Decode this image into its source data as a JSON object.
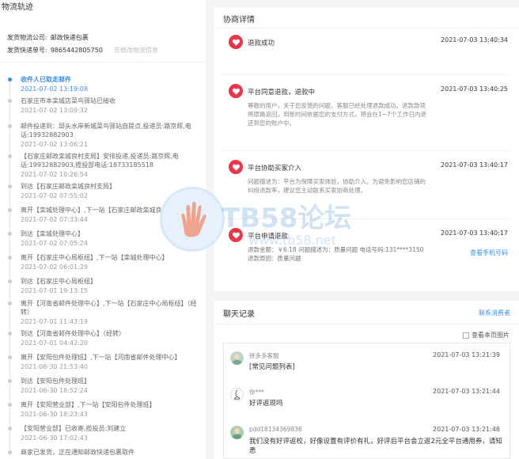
{
  "left": {
    "title": "物流轨迹",
    "company_label": "发货物流公司:",
    "company_value": "邮政快递包裹",
    "tracking_label": "发货快递单号:",
    "tracking_value": "9865442805750",
    "tracking_link": "去修改物流信息",
    "timeline": [
      {
        "text": "收件人已取走邮件",
        "time": "2021-07-02 13:19:08"
      },
      {
        "text": "石家庄市本栾城店菜鸟驿站已接收",
        "time": "2021-07-02 13:09:32"
      },
      {
        "text": "邮件投递到：邱头水岸新城菜鸟驿站自提点,投递员:路京辉,电话:19932882903",
        "time": "2021-07-02 13:06:21"
      },
      {
        "text": "【石家庄邮政栾城良村支局】安排投递,投递员:路京辉,电话:19932882903,揽投部电话:18733185518",
        "time": "2021-07-02 10:26:54"
      },
      {
        "text": "到达【石家庄邮政栾城良村支局】",
        "time": "2021-07-02 07:55:02"
      },
      {
        "text": "离开【栾城处理中心】,下一站【石家庄邮政栾城良村支局】",
        "time": "2021-07-02 07:33:44"
      },
      {
        "text": "到达【栾城处理中心】",
        "time": "2021-07-02 07:05:24"
      },
      {
        "text": "离开【石家庄中心局枢纽】,下一站【栾城处理中心】",
        "time": "2021-07-02 06:01:29"
      },
      {
        "text": "到达【石家庄中心局枢纽】",
        "time": "2021-07-01 19:13:15"
      },
      {
        "text": "离开【河南省邮件处理中心】,下一站【石家庄中心局枢纽】（经转）",
        "time": "2021-07-01 11:43:19"
      },
      {
        "text": "到达【河南省邮件处理中心】（经转）",
        "time": "2021-07-01 04:42:20"
      },
      {
        "text": "离开【安阳包件处理班】,下一站【河南省邮件处理中心】",
        "time": "2021-06-30 21:53:40"
      },
      {
        "text": "到达【安阳包件处理班】",
        "time": "2021-06-30 18:52:24"
      },
      {
        "text": "离开【安阳营业部】,下一站【安阳包件处理班】",
        "time": "2021-06-30 18:23:43"
      },
      {
        "text": "【安阳营业部】已收寄,揽投员:刘建立",
        "time": "2021-06-30 17:02:43"
      },
      {
        "text": "商家已发货，正在通知邮政快递包裹取件",
        "time": ""
      }
    ]
  },
  "detail": {
    "title": "协商详情",
    "events": [
      {
        "title": "退款成功",
        "time": "2021-07-03 13:40:34",
        "body": ""
      },
      {
        "title": "平台同意退款，退款中",
        "time": "2021-07-03 13:40:25",
        "body": "尊敬的用户，关于您反馈的问题，客服已经处理退款成功。退款款项将原路返回，到账时间依据您的支付方式，将会在1~7个工作日内退还到您的账户中。"
      },
      {
        "title": "平台协助买家介入",
        "time": "2021-07-03 13:40:17",
        "body": "问题描述为：平台为保障买家体验，协助介入。为避免影响您店铺的纠纷退款率，建议您主动联系买家协商处理。"
      },
      {
        "title": "平台申请退款",
        "time": "2021-07-03 13:40:17",
        "body": "退款金额：￥6.18 问题描述为：质量问题 电话号码:131****3150 退款原因：质量问题"
      }
    ],
    "phone_link": "查看手机号码"
  },
  "chat": {
    "title": "聊天记录",
    "link": "联系消费者",
    "show_images": "查看本页图片",
    "messages": [
      {
        "name": "拼多多客服",
        "time": "2021-07-03 13:21:39",
        "text": "[常见问题列表]"
      },
      {
        "name": "你***",
        "time": "2021-07-03 13:21:44",
        "text": "好评返现吗"
      },
      {
        "name": "pdd18134369836",
        "time": "2021-07-03 13:21:48",
        "text": "我们没有好评返校，好像设置有评价有礼，好评后平台会立返2元全平台通用券，请知悉"
      }
    ]
  },
  "watermark": {
    "text": "TB58论坛",
    "url": "www.tb58.net"
  },
  "colors": {
    "accent": "#3a8ee6",
    "badge": "#e8364a"
  }
}
